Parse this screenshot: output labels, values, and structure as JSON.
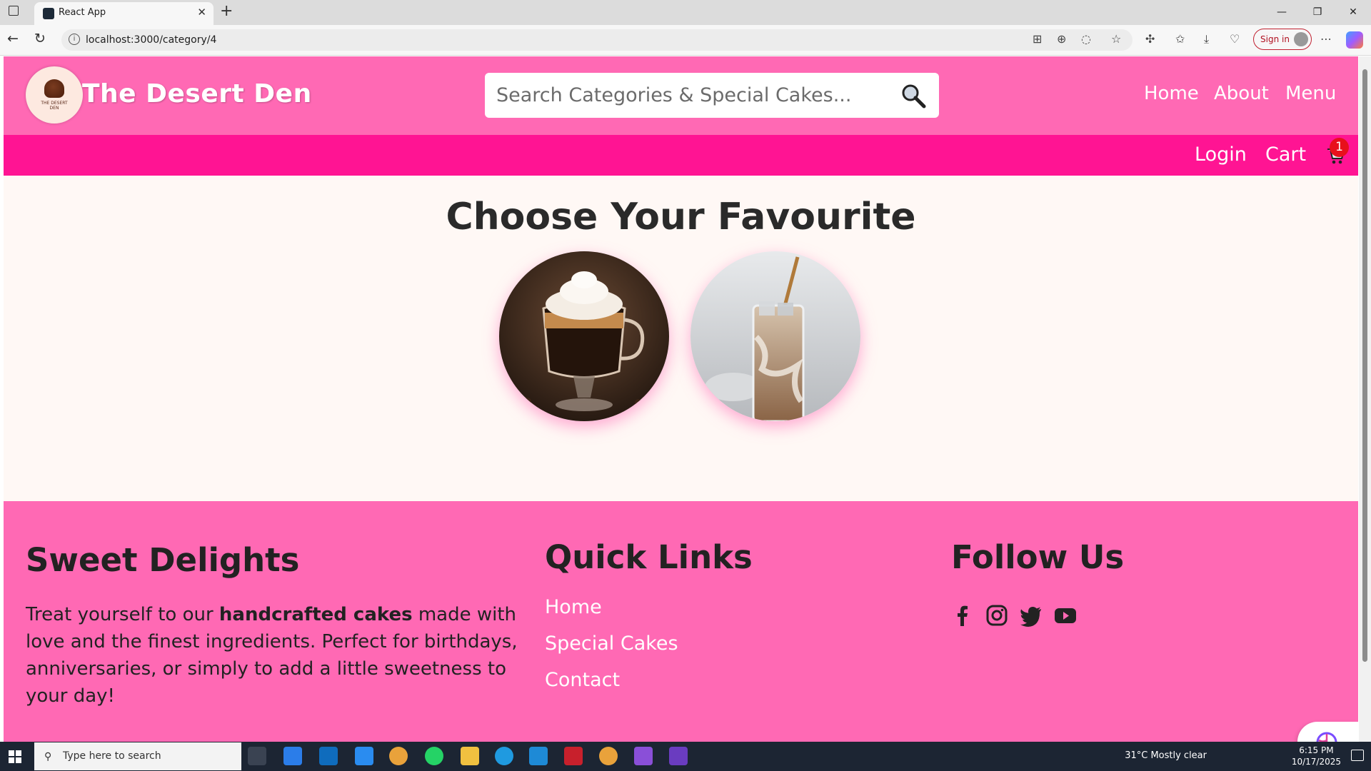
{
  "browser": {
    "tab_title": "React App",
    "url": "localhost:3000/category/4",
    "sign_in_label": "Sign in"
  },
  "site": {
    "brand": "The Desert Den",
    "logo_text": "THE DESERT DEN",
    "search_placeholder": "Search Categories & Special Cakes...",
    "nav": {
      "home": "Home",
      "about": "About",
      "menu": "Menu"
    },
    "subnav": {
      "login": "Login",
      "cart": "Cart",
      "cart_count": "1"
    }
  },
  "main": {
    "title": "Choose Your Favourite"
  },
  "footer": {
    "col1_title": "Sweet Delights",
    "desc_pre": "Treat yourself to our ",
    "desc_bold": "handcrafted cakes",
    "desc_post": " made with love and the finest ingredients. Perfect for birthdays, anniversaries, or simply to add a little sweetness to your day!",
    "col2_title": "Quick Links",
    "links": [
      "Home",
      "Special Cakes",
      "Contact"
    ],
    "col3_title": "Follow Us"
  },
  "taskbar": {
    "search_placeholder": "Type here to search",
    "weather": "31°C  Mostly clear",
    "time": "6:15 PM",
    "date": "10/17/2025"
  },
  "colors": {
    "header": "#ff69b4",
    "subbar": "#ff1493",
    "page_bg": "#fff8f5",
    "badge": "#e8101c"
  }
}
